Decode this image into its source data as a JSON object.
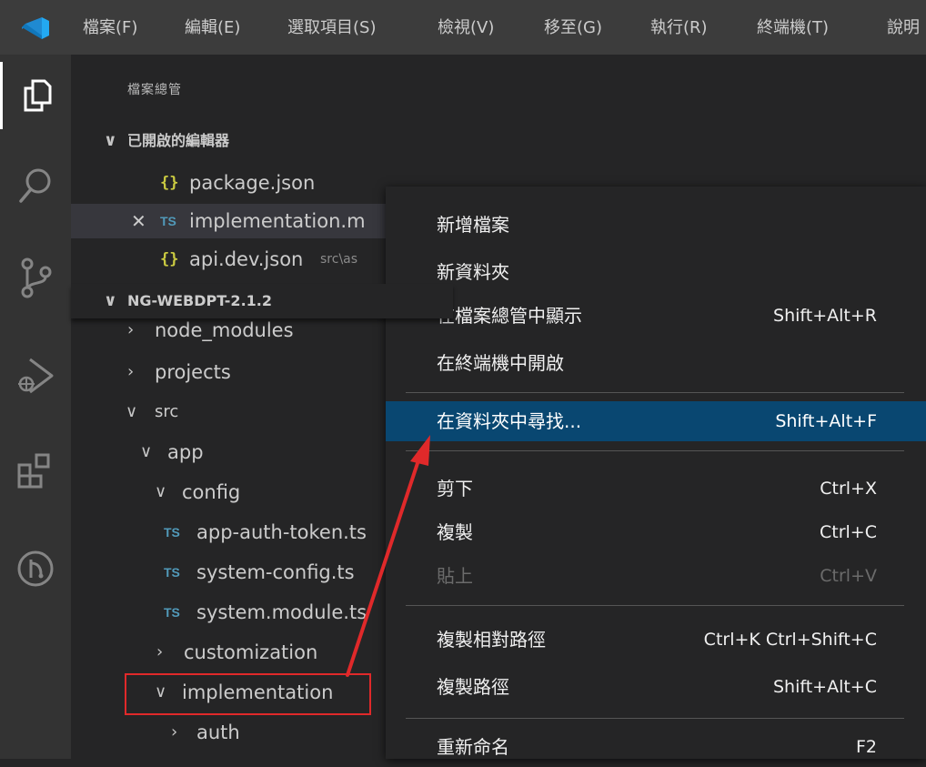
{
  "menubar": {
    "items": [
      "檔案(F)",
      "編輯(E)",
      "選取項目(S)",
      "檢視(V)",
      "移至(G)",
      "執行(R)",
      "終端機(T)",
      "說明"
    ]
  },
  "activity_bar": {
    "icons": [
      "explorer-icon",
      "search-icon",
      "source-control-icon",
      "run-debug-icon",
      "extensions-icon",
      "remote-explorer-icon"
    ]
  },
  "sidebar": {
    "title": "檔案總管",
    "open_editors": {
      "header": "已開啟的編輯器",
      "items": [
        {
          "icon": "{}",
          "name": "package.json",
          "hint": ""
        },
        {
          "icon": "TS",
          "name": "implementation.m",
          "hint": ""
        },
        {
          "icon": "{}",
          "name": "api.dev.json",
          "hint": "src\\as"
        }
      ]
    },
    "workspace": {
      "header": "NG-WEBDPT-2.1.2",
      "items": [
        {
          "chev": ">",
          "name": "node_modules"
        },
        {
          "chev": ">",
          "name": "projects"
        },
        {
          "chev": "v",
          "name": "src"
        },
        {
          "chev": "v",
          "name": "app"
        },
        {
          "chev": "v",
          "name": "config"
        },
        {
          "icon": "TS",
          "name": "app-auth-token.ts"
        },
        {
          "icon": "TS",
          "name": "system-config.ts"
        },
        {
          "icon": "TS",
          "name": "system.module.ts"
        },
        {
          "chev": ">",
          "name": "customization"
        },
        {
          "chev": "v",
          "name": "implementation"
        },
        {
          "chev": ">",
          "name": "auth"
        }
      ]
    }
  },
  "context_menu": {
    "items": [
      {
        "label": "新增檔案",
        "shortcut": ""
      },
      {
        "label": "新資料夾",
        "shortcut": ""
      },
      {
        "label": "在檔案總管中顯示",
        "shortcut": "Shift+Alt+R"
      },
      {
        "label": "在終端機中開啟",
        "shortcut": ""
      },
      {
        "label": "在資料夾中尋找...",
        "shortcut": "Shift+Alt+F"
      },
      {
        "label": "剪下",
        "shortcut": "Ctrl+X"
      },
      {
        "label": "複製",
        "shortcut": "Ctrl+C"
      },
      {
        "label": "貼上",
        "shortcut": "Ctrl+V"
      },
      {
        "label": "複製相對路徑",
        "shortcut": "Ctrl+K Ctrl+Shift+C"
      },
      {
        "label": "複製路徑",
        "shortcut": "Shift+Alt+C"
      },
      {
        "label": "重新命名",
        "shortcut": "F2"
      }
    ]
  },
  "colors": {
    "menu_selection": "#094771",
    "annotation_red": "#e0292a",
    "ts_icon": "#519aba",
    "json_icon": "#cbcb41",
    "vscode_blue": "#23a9f2"
  }
}
